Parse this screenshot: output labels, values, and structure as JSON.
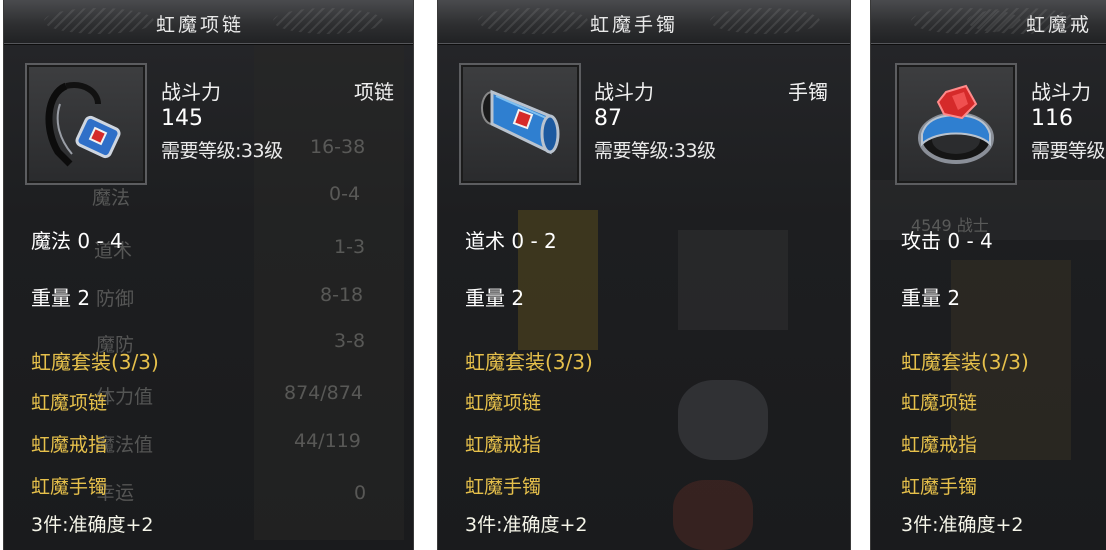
{
  "panels": [
    {
      "title": "虹魔项链",
      "power_label": "战斗力",
      "power_value": "145",
      "item_type": "项链",
      "level_req": "需要等级:33级",
      "attribute": "魔法 0 - 4",
      "weight": "重量 2",
      "set_title": "虹魔套装(3/3)",
      "set_items": [
        "虹魔项链",
        "虹魔戒指",
        "虹魔手镯"
      ],
      "set_bonus": "3件:准确度+2",
      "icon": "necklace-icon",
      "background_text": {
        "row0_value": "16-38",
        "row1_label": "魔法",
        "row1_value": "0-4",
        "row2_label": "道术",
        "row2_value": "1-3",
        "row3_label": "防御",
        "row3_value": "8-18",
        "row4_label": "魔防",
        "row4_value": "3-8",
        "row5_label": "体力值",
        "row5_value": "874/874",
        "row6_label": "魔法值",
        "row6_value": "44/119",
        "row7_label": "幸运",
        "row7_value": "0"
      }
    },
    {
      "title": "虹魔手镯",
      "power_label": "战斗力",
      "power_value": "87",
      "item_type": "手镯",
      "level_req": "需要等级:33级",
      "attribute": "道术 0 - 2",
      "weight": "重量 2",
      "set_title": "虹魔套装(3/3)",
      "set_items": [
        "虹魔项链",
        "虹魔戒指",
        "虹魔手镯"
      ],
      "set_bonus": "3件:准确度+2",
      "icon": "bracelet-icon"
    },
    {
      "title": "虹魔戒",
      "power_label": "战斗力",
      "power_value": "116",
      "level_req": "需要等级",
      "attribute": "攻击 0 - 4",
      "weight": "重量 2",
      "set_title": "虹魔套装(3/3)",
      "set_items": [
        "虹魔项链",
        "虹魔戒指",
        "虹魔手镯"
      ],
      "set_bonus": "3件:准确度+2",
      "icon": "ring-icon",
      "background_text": {
        "overlay": "4549 战士"
      }
    }
  ],
  "colors": {
    "set_text": "#e6c04b",
    "panel_bg": "#1d1e20",
    "gem_red": "#d52a2a",
    "gem_blue": "#2f7fd0"
  }
}
